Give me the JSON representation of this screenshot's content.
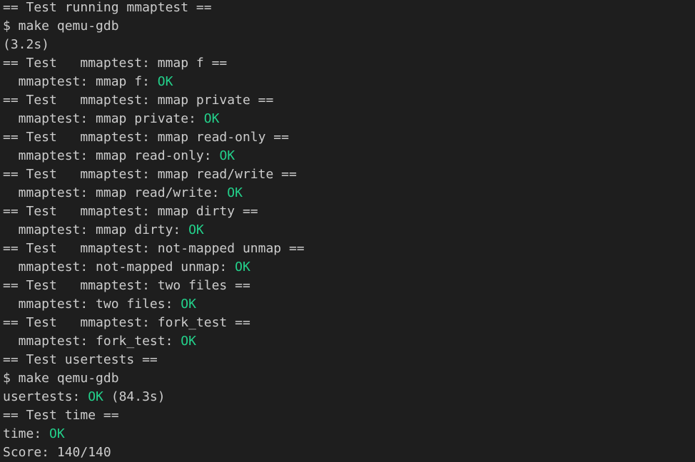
{
  "colors": {
    "background": "#1e1e1e",
    "text": "#cccccc",
    "ok": "#23d18b"
  },
  "lines": [
    [
      {
        "text": "== Test running mmaptest =="
      }
    ],
    [
      {
        "text": "$ make qemu-gdb"
      }
    ],
    [
      {
        "text": "(3.2s)"
      }
    ],
    [
      {
        "text": "== Test   mmaptest: mmap f =="
      }
    ],
    [
      {
        "text": "  mmaptest: mmap f: "
      },
      {
        "text": "OK",
        "ok": true
      }
    ],
    [
      {
        "text": "== Test   mmaptest: mmap private =="
      }
    ],
    [
      {
        "text": "  mmaptest: mmap private: "
      },
      {
        "text": "OK",
        "ok": true
      }
    ],
    [
      {
        "text": "== Test   mmaptest: mmap read-only =="
      }
    ],
    [
      {
        "text": "  mmaptest: mmap read-only: "
      },
      {
        "text": "OK",
        "ok": true
      }
    ],
    [
      {
        "text": "== Test   mmaptest: mmap read/write =="
      }
    ],
    [
      {
        "text": "  mmaptest: mmap read/write: "
      },
      {
        "text": "OK",
        "ok": true
      }
    ],
    [
      {
        "text": "== Test   mmaptest: mmap dirty =="
      }
    ],
    [
      {
        "text": "  mmaptest: mmap dirty: "
      },
      {
        "text": "OK",
        "ok": true
      }
    ],
    [
      {
        "text": "== Test   mmaptest: not-mapped unmap =="
      }
    ],
    [
      {
        "text": "  mmaptest: not-mapped unmap: "
      },
      {
        "text": "OK",
        "ok": true
      }
    ],
    [
      {
        "text": "== Test   mmaptest: two files =="
      }
    ],
    [
      {
        "text": "  mmaptest: two files: "
      },
      {
        "text": "OK",
        "ok": true
      }
    ],
    [
      {
        "text": "== Test   mmaptest: fork_test =="
      }
    ],
    [
      {
        "text": "  mmaptest: fork_test: "
      },
      {
        "text": "OK",
        "ok": true
      }
    ],
    [
      {
        "text": "== Test usertests =="
      }
    ],
    [
      {
        "text": "$ make qemu-gdb"
      }
    ],
    [
      {
        "text": "usertests: "
      },
      {
        "text": "OK",
        "ok": true
      },
      {
        "text": " (84.3s)"
      }
    ],
    [
      {
        "text": "== Test time =="
      }
    ],
    [
      {
        "text": "time: "
      },
      {
        "text": "OK",
        "ok": true
      }
    ],
    [
      {
        "text": "Score: 140/140"
      }
    ]
  ]
}
